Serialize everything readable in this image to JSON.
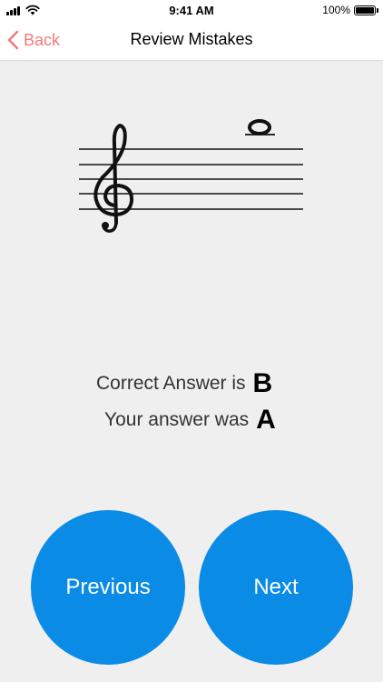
{
  "status_bar": {
    "time": "9:41 AM",
    "battery_percent": "100%",
    "signal_icon": "cellular-signal-icon",
    "wifi_icon": "wifi-icon",
    "battery_icon": "battery-icon",
    "battery_level": 1.0
  },
  "nav": {
    "back_label": "Back",
    "back_icon": "chevron-left-icon",
    "title": "Review Mistakes",
    "accent_color": "#f27b80"
  },
  "staff": {
    "clef": "treble-clef-icon",
    "note": "whole-note-icon",
    "note_position": "above staff with one ledger line"
  },
  "answers": {
    "correct_label": "Correct Answer is",
    "correct_value": "B",
    "user_label": "Your answer was",
    "user_value": "A"
  },
  "buttons": {
    "previous_label": "Previous",
    "next_label": "Next",
    "color": "#0a8be6"
  }
}
